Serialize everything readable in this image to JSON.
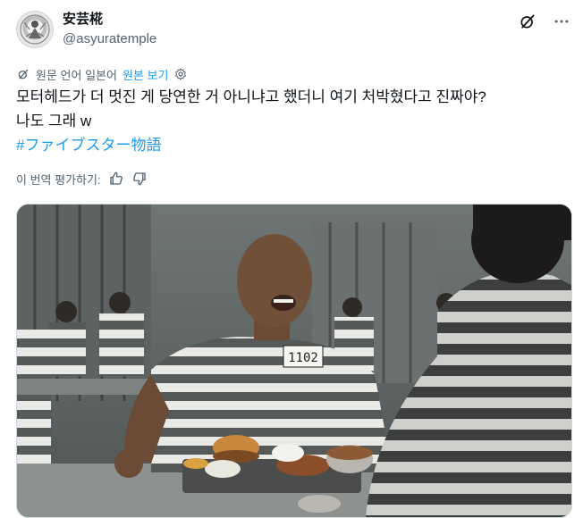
{
  "author": {
    "display_name": "安芸椛",
    "handle": "@asyuratemple"
  },
  "translation": {
    "source_language": "원문 언어 일본어",
    "show_original": "원본 보기"
  },
  "post": {
    "line1": "모터헤드가 더 멋진 게 당연한 거 아니냐고 했더니 여기 처박혔다고 진짜야?",
    "line2": "나도 그래 w",
    "hashtag": "#ファイブスター物語"
  },
  "rating": {
    "label": "이 번역 평가하기:"
  },
  "media": {
    "shirt_number": "1102"
  },
  "icons": {
    "grok": "grok-icon",
    "more": "more-options-icon",
    "translate": "translate-icon",
    "settings": "gear-icon",
    "thumbs_up": "thumbs-up-icon",
    "thumbs_down": "thumbs-down-icon"
  },
  "colors": {
    "text": "#0f1419",
    "secondary": "#536471",
    "link": "#1d9bf0"
  }
}
